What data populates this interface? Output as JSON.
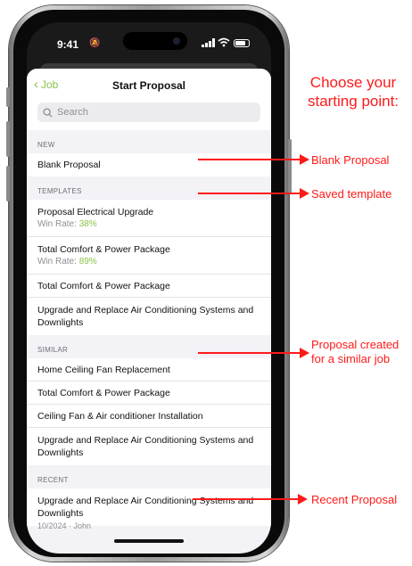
{
  "status_bar": {
    "time": "9:41"
  },
  "nav": {
    "back_label": "Job",
    "title": "Start Proposal"
  },
  "search": {
    "placeholder": "Search"
  },
  "sections": {
    "new": {
      "header": "NEW",
      "items": [
        "Blank Proposal"
      ]
    },
    "templates": {
      "header": "TEMPLATES",
      "items": [
        {
          "title": "Proposal Electrical Upgrade",
          "winrate_label": "Win Rate:",
          "winrate_value": "38%"
        },
        {
          "title": "Total Comfort & Power Package",
          "winrate_label": "Win Rate:",
          "winrate_value": "89%"
        },
        {
          "title": "Total Comfort & Power Package"
        },
        {
          "title": "Upgrade and Replace Air Conditioning Systems and Downlights"
        }
      ]
    },
    "similar": {
      "header": "SIMILAR",
      "items": [
        "Home Ceiling Fan Replacement",
        "Total Comfort & Power Package",
        "Ceiling Fan & Air conditioner Installation",
        "Upgrade and Replace Air Conditioning Systems and Downlights"
      ]
    },
    "recent": {
      "header": "RECENT",
      "items": [
        {
          "title": "Upgrade and Replace Air Conditioning Systems and Downlights",
          "meta": "10/2024 · John"
        }
      ]
    }
  },
  "annotations": {
    "headline": "Choose your starting point:",
    "blank": "Blank Proposal",
    "template": "Saved template",
    "similar": "Proposal created for a similar job",
    "recent": "Recent Proposal"
  },
  "colors": {
    "accent": "#8bc34a",
    "annotation": "#ff1a1a"
  }
}
